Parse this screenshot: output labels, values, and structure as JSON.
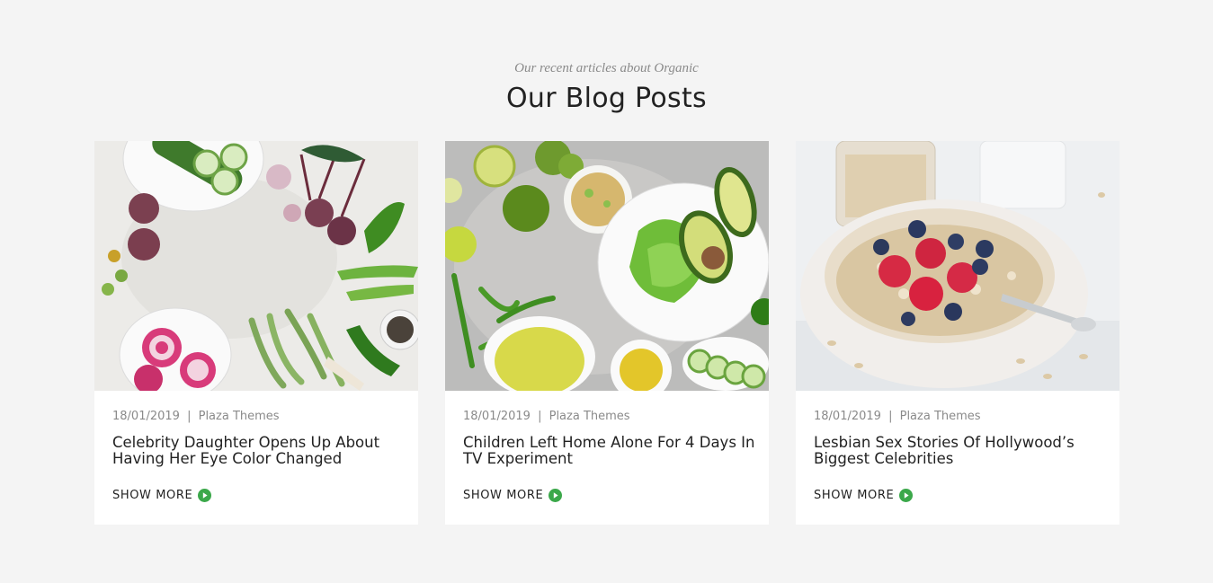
{
  "section": {
    "subtitle": "Our recent articles about Organic",
    "title": "Our Blog Posts"
  },
  "colors": {
    "background": "#f4f4f4",
    "card": "#ffffff",
    "accent_green": "#3ba84a",
    "text_dark": "#222222",
    "text_muted": "#8a8a8a"
  },
  "posts": [
    {
      "image": "vegetables-flatlay-image",
      "date": "18/01/2019",
      "separator": "|",
      "author": "Plaza Themes",
      "title": "Celebrity Daughter Opens Up About Having Her Eye Color Changed",
      "link_label": "SHOW MORE",
      "link_icon": "play-circle-icon"
    },
    {
      "image": "salad-avocado-image",
      "date": "18/01/2019",
      "separator": "|",
      "author": "Plaza Themes",
      "title": "Children Left Home Alone For 4 Days In TV Experiment",
      "link_label": "SHOW MORE",
      "link_icon": "play-circle-icon"
    },
    {
      "image": "oatmeal-berries-image",
      "date": "18/01/2019",
      "separator": "|",
      "author": "Plaza Themes",
      "title": "Lesbian Sex Stories Of Hollywood’s Biggest Celebrities",
      "link_label": "SHOW MORE",
      "link_icon": "play-circle-icon"
    }
  ]
}
